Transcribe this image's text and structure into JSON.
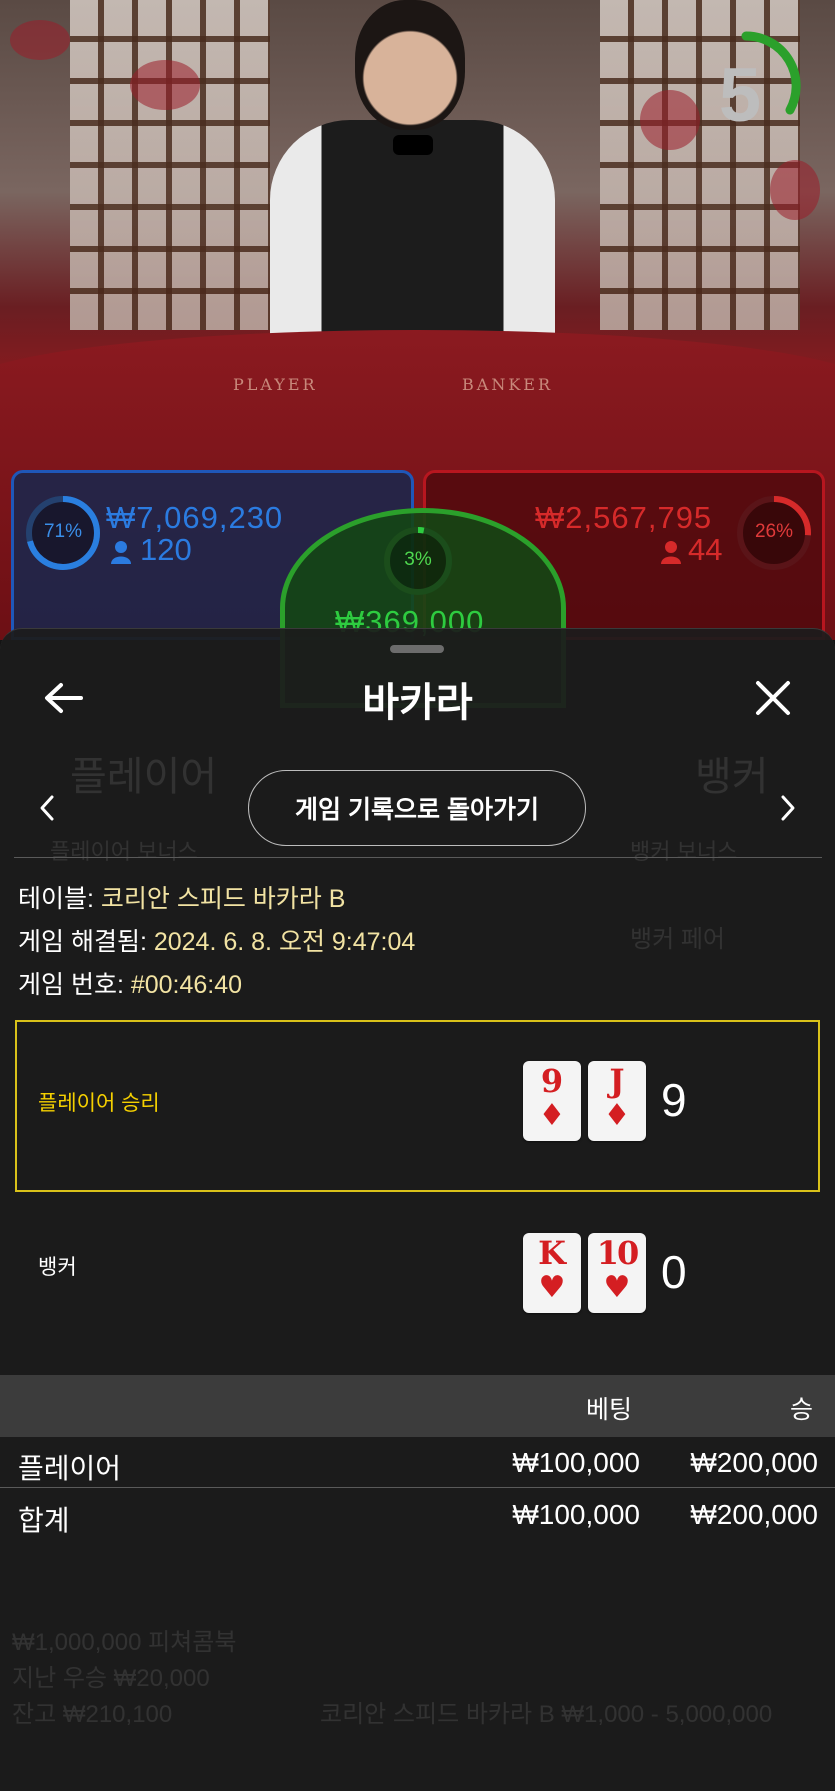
{
  "stage": {
    "felt_player": "PLAYER",
    "felt_banker": "BANKER",
    "countdown": "5",
    "colors": {
      "player": "#1f57b8",
      "banker": "#b7161f",
      "tie": "#2ba02b"
    }
  },
  "bets": {
    "player": {
      "percent": "71%",
      "percent_value": 0.71,
      "amount": "₩7,069,230",
      "users": "120"
    },
    "banker": {
      "percent": "26%",
      "percent_value": 0.26,
      "amount": "₩2,567,795",
      "users": "44"
    },
    "tie": {
      "percent": "3%",
      "percent_value": 0.03,
      "amount": "₩369,000"
    }
  },
  "sheet": {
    "title": "바카라",
    "back_icon": "arrow-left-icon",
    "close_icon": "close-icon",
    "prev_icon": "chevron-left-icon",
    "next_icon": "chevron-right-icon",
    "back_to_history": "게임 기록으로 돌아가기",
    "info": [
      {
        "key": "테이블: ",
        "value": "코리안 스피드 바카라 B"
      },
      {
        "key": "게임 해결됨: ",
        "value": "2024. 6. 8. 오전 9:47:04"
      },
      {
        "key": "게임 번호: ",
        "value": "#00:46:40"
      }
    ],
    "result": {
      "winner_label": "플레이어 승리",
      "player_cards": [
        {
          "rank": "9",
          "suit": "♦"
        },
        {
          "rank": "J",
          "suit": "♦"
        }
      ],
      "player_score": "9",
      "banker_label": "뱅커",
      "banker_cards": [
        {
          "rank": "K",
          "suit": "♥"
        },
        {
          "rank": "10",
          "suit": "♥"
        }
      ],
      "banker_score": "0"
    },
    "table": {
      "col_bet": "베팅",
      "col_win": "승",
      "rows": [
        {
          "label": "플레이어",
          "bet": "₩100,000",
          "win": "₩200,000"
        },
        {
          "label": "합계",
          "bet": "₩100,000",
          "win": "₩200,000"
        }
      ]
    }
  }
}
